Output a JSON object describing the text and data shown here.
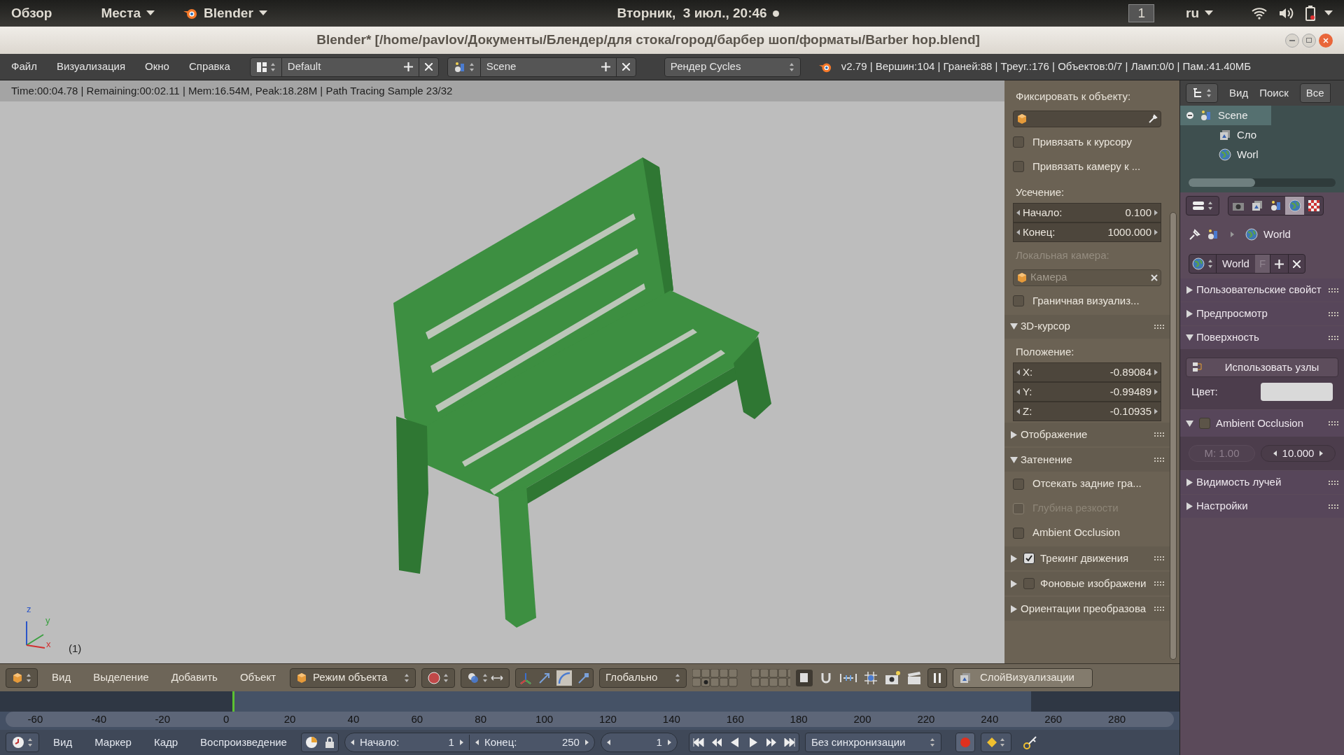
{
  "system_bar": {
    "activities": "Обзор",
    "places": "Места",
    "app": "Blender",
    "clock": "Вторник,  3 июл., 20:46",
    "workspace": "1",
    "language": "ru"
  },
  "window": {
    "title": "Blender* [/home/pavlov/Документы/Блендер/для стока/город/барбер шоп/форматы/Barber hop.blend]"
  },
  "info_header": {
    "menus": [
      "Файл",
      "Визуализация",
      "Окно",
      "Справка"
    ],
    "screen": "Default",
    "scene": "Scene",
    "engine": "Рендер Cycles",
    "stats": "v2.79 | Вершин:104 | Граней:88 | Треуг.:176 | Объектов:0/7 | Ламп:0/0 | Пам.:41.40МБ"
  },
  "viewport": {
    "render_status": "Time:00:04.78 | Remaining:00:02.11 | Mem:16.54M, Peak:18.28M | Path Tracing Sample 23/32",
    "axes": [
      "z",
      "y",
      "x"
    ],
    "frame_label": "(1)"
  },
  "view_panel": [
    {
      "kind": "label",
      "text": "Фиксировать к объекту:",
      "disabled": false
    },
    {
      "kind": "picker"
    },
    {
      "kind": "checkbox",
      "text": "Привязать к курсору",
      "checked": false,
      "disabled": false
    },
    {
      "kind": "checkbox",
      "text": "Привязать камеру к ...",
      "checked": false,
      "disabled": false
    },
    {
      "kind": "label",
      "text": "Усечение:",
      "disabled": false
    },
    {
      "kind": "number",
      "text": "Начало:",
      "value": "0.100"
    },
    {
      "kind": "number",
      "text": "Конец:",
      "value": "1000.000"
    },
    {
      "kind": "label",
      "text": "Локальная камера:",
      "disabled": true
    },
    {
      "kind": "object",
      "text": "Камера"
    },
    {
      "kind": "checkbox",
      "text": "Граничная визуализ...",
      "checked": false,
      "disabled": false
    },
    {
      "kind": "panel",
      "text": "3D-курсор",
      "expanded": true
    },
    {
      "kind": "label",
      "text": "Положение:",
      "disabled": false
    },
    {
      "kind": "number",
      "text": "X:",
      "value": "-0.89084"
    },
    {
      "kind": "number",
      "text": "Y:",
      "value": "-0.99489"
    },
    {
      "kind": "number",
      "text": "Z:",
      "value": "-0.10935"
    },
    {
      "kind": "panel",
      "text": "Отображение",
      "expanded": false
    },
    {
      "kind": "panel",
      "text": "Затенение",
      "expanded": true
    },
    {
      "kind": "checkbox",
      "text": "Отсекать задние гра...",
      "checked": false,
      "disabled": false
    },
    {
      "kind": "checkbox",
      "text": "Глубина резкости",
      "checked": false,
      "disabled": true
    },
    {
      "kind": "checkbox",
      "text": "Ambient Occlusion",
      "checked": false,
      "disabled": false
    },
    {
      "kind": "panel_check",
      "text": "Трекинг движения",
      "expanded": false,
      "checked": true
    },
    {
      "kind": "panel_check",
      "text": "Фоновые изображени",
      "expanded": false,
      "checked": false
    },
    {
      "kind": "panel",
      "text": "Ориентации преобразова",
      "expanded": false
    }
  ],
  "outliner": {
    "menus": [
      "Вид",
      "Поиск"
    ],
    "filter": "Все",
    "rows": [
      {
        "label": "Scene",
        "selected": true,
        "children": [
          {
            "label": "Сло",
            "selected": false
          },
          {
            "label": "Worl",
            "selected": false
          }
        ]
      }
    ]
  },
  "properties": {
    "tabs": [
      {
        "kind": "render",
        "selected": false
      },
      {
        "kind": "layers",
        "selected": false
      },
      {
        "kind": "scene",
        "selected": false
      },
      {
        "kind": "world",
        "selected": true
      },
      {
        "kind": "texture",
        "selected": false
      }
    ],
    "breadcrumb": "World",
    "datablock": "World",
    "fake_user": "F",
    "panels": [
      {
        "kind": "panel",
        "text": "Пользовательские свойст",
        "expanded": false
      },
      {
        "kind": "panel",
        "text": "Предпросмотр",
        "expanded": false
      },
      {
        "kind": "panel",
        "text": "Поверхность",
        "expanded": true
      },
      {
        "kind": "button",
        "text": "Использовать узлы"
      },
      {
        "kind": "color",
        "text": "Цвет:"
      },
      {
        "kind": "panel_check",
        "text": "Ambient Occlusion",
        "expanded": true,
        "checked": false
      },
      {
        "kind": "pair",
        "text": "M: 1.00",
        "value": "10.000"
      },
      {
        "kind": "panel",
        "text": "Видимость лучей",
        "expanded": false
      },
      {
        "kind": "panel",
        "text": "Настройки",
        "expanded": false
      }
    ]
  },
  "view3d_header": {
    "menus": [
      "Вид",
      "Выделение",
      "Добавить",
      "Объект"
    ],
    "mode": "Режим объекта",
    "orientation": "Глобально",
    "render_layer": "СлойВизуализации"
  },
  "timeline": {
    "ruler": [
      "-60",
      "-40",
      "-20",
      "0",
      "20",
      "40",
      "60",
      "80",
      "100",
      "120",
      "140",
      "160",
      "180",
      "200",
      "220",
      "240",
      "260",
      "280"
    ],
    "menus": [
      "Вид",
      "Маркер",
      "Кадр",
      "Воспроизведение"
    ],
    "start_label": "Начало:",
    "start": "1",
    "end_label": "Конец:",
    "end": "250",
    "current": "1",
    "sync": "Без синхронизации"
  }
}
